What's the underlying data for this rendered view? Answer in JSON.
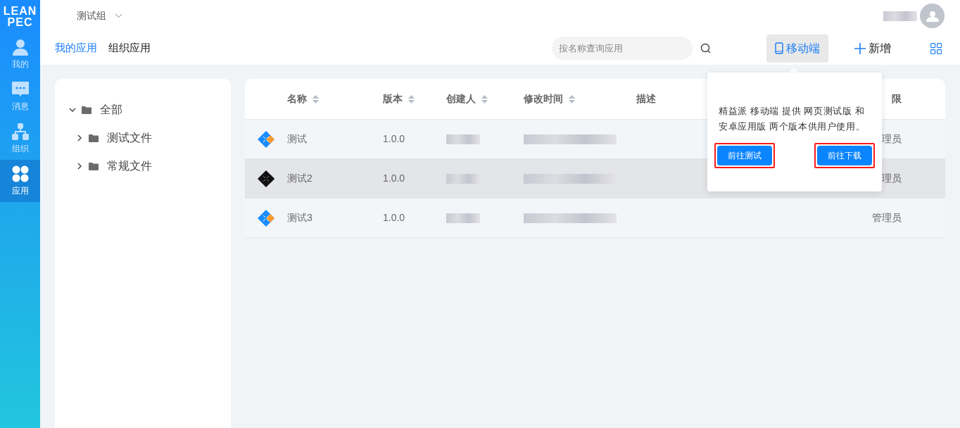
{
  "logo": {
    "lines": [
      "LEAN",
      "PEC"
    ]
  },
  "sidebar": {
    "items": [
      {
        "label": "我的",
        "kind": "user",
        "selected": false
      },
      {
        "label": "消息",
        "kind": "message",
        "selected": false
      },
      {
        "label": "组织",
        "kind": "org",
        "selected": false
      },
      {
        "label": "应用",
        "kind": "apps",
        "selected": true
      }
    ]
  },
  "header": {
    "group": "测试组"
  },
  "tabs": [
    {
      "label": "我的应用",
      "selected": true
    },
    {
      "label": "组织应用",
      "selected": false
    }
  ],
  "search": {
    "placeholder": "按名称查询应用"
  },
  "toolbar": {
    "mobile": {
      "label": "移动端",
      "active": true
    },
    "add": {
      "label": "新增"
    }
  },
  "tree": [
    {
      "label": "全部",
      "expanded": true,
      "children": [
        {
          "label": "测试文件",
          "expanded": false
        },
        {
          "label": "常规文件",
          "expanded": false
        }
      ]
    }
  ],
  "table": {
    "columns": [
      {
        "label": "名称",
        "sortable": true
      },
      {
        "label": "版本",
        "sortable": true
      },
      {
        "label": "创建人",
        "sortable": true
      },
      {
        "label": "修改时间",
        "sortable": true
      },
      {
        "label": "描述",
        "sortable": false
      },
      {
        "label": "限",
        "sortable": false
      }
    ],
    "rows": [
      {
        "kind": "colored",
        "name": "测试",
        "version": "1.0.0",
        "permission": "理员",
        "selected": false
      },
      {
        "kind": "dark",
        "name": "测试2",
        "version": "1.0.0",
        "permission": "理员",
        "selected": true
      },
      {
        "kind": "colored",
        "name": "测试3",
        "version": "1.0.0",
        "permission": "管理员",
        "selected": false
      }
    ]
  },
  "popover": {
    "text": "精益派 移动端 提供 网页测试版 和安卓应用版 两个版本供用户使用。",
    "buttons": [
      {
        "label": "前往测试",
        "highlighted": true
      },
      {
        "label": "前往下载",
        "highlighted": true
      }
    ]
  }
}
